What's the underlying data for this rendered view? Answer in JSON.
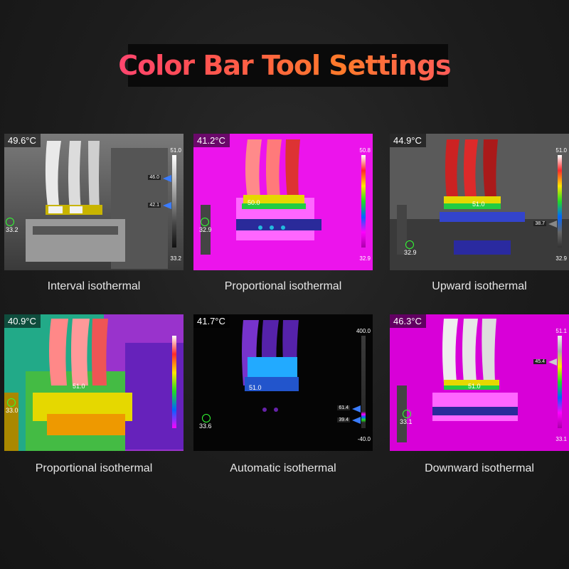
{
  "title": "Color Bar Tool Settings",
  "panels": [
    {
      "id": "p1",
      "caption": "Interval isothermal",
      "temp": "49.6°C",
      "scale_max": "51.0",
      "scale_min": "33.2",
      "spot_temp": "33.2",
      "markers": [
        "46.0",
        "42.1"
      ],
      "palette": "grey",
      "bar_colors": [
        "#ffffff",
        "#c8c8c8",
        "#888888",
        "#444444",
        "#111111"
      ]
    },
    {
      "id": "p2",
      "caption": "Proportional isothermal",
      "temp": "41.2°C",
      "scale_max": "50.8",
      "scale_min": "32.9",
      "spot_temp": "32.9",
      "center_temp": "50.0",
      "palette": "magenta",
      "bar_colors": [
        "#ffffff",
        "#ff2a2a",
        "#ffe600",
        "#22dd22",
        "#0066ff",
        "#ff00ff",
        "#aa00aa"
      ]
    },
    {
      "id": "p3",
      "caption": "Upward isothermal",
      "temp": "44.9°C",
      "scale_max": "51.0",
      "scale_min": "32.9",
      "spot_temp": "32.9",
      "center_temp": "51.0",
      "markers": [
        "38.7"
      ],
      "palette": "grey-hot",
      "bar_colors": [
        "#ffffff",
        "#ff2a2a",
        "#ffe600",
        "#22dd22",
        "#0066ff",
        "#666666",
        "#333333"
      ]
    },
    {
      "id": "p4",
      "caption": "Proportional isothermal",
      "temp": "40.9°C",
      "scale_max": "",
      "scale_min": "",
      "spot_temp": "33.0",
      "center_temp": "51.0",
      "palette": "rainbow",
      "bar_colors": [
        "#ffffff",
        "#ff2a2a",
        "#ffe600",
        "#22dd22",
        "#0066ff",
        "#ff00ff"
      ]
    },
    {
      "id": "p5",
      "caption": "Automatic isothermal",
      "temp": "41.7°C",
      "scale_max": "400.0",
      "scale_min": "-40.0",
      "spot_temp": "33.6",
      "center_temp": "51.0",
      "markers": [
        "61.4",
        "39.4"
      ],
      "palette": "black",
      "bar_colors": [
        "#3a3a3a",
        "#2a2a2a",
        "#ff00ff",
        "#0066ff",
        "#22dd22",
        "#2a2a2a"
      ]
    },
    {
      "id": "p6",
      "caption": "Downward isothermal",
      "temp": "46.3°C",
      "scale_max": "51.1",
      "scale_min": "33.1",
      "spot_temp": "33.1",
      "center_temp": "51.0",
      "markers": [
        "45.4"
      ],
      "palette": "magenta-white",
      "bar_colors": [
        "#eeeeee",
        "#aaaaaa",
        "#ffe600",
        "#22dd22",
        "#0066ff",
        "#ff00ff",
        "#aa00aa"
      ]
    }
  ]
}
